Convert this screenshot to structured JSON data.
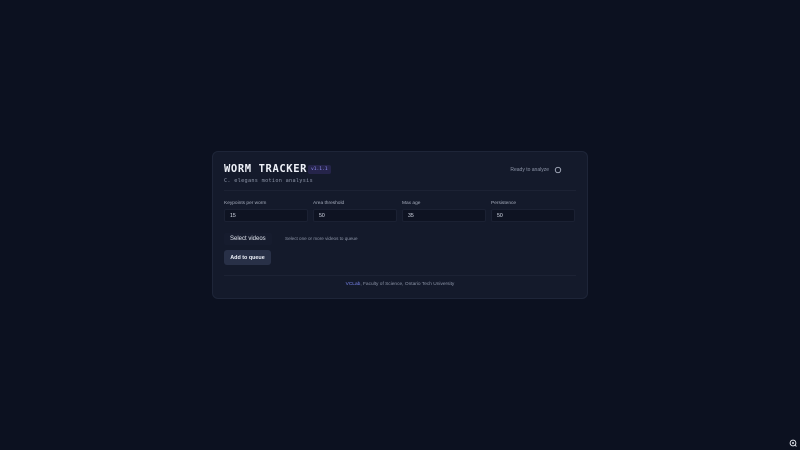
{
  "header": {
    "title": "WORM TRACKER",
    "version": "v1.1.1",
    "subtitle": "C. elegans motion analysis",
    "status": "Ready to analyze",
    "theme_icon": "circle-icon"
  },
  "fields": [
    {
      "label": "Keypoints per worm",
      "value": "15"
    },
    {
      "label": "Area threshold",
      "value": "50"
    },
    {
      "label": "Max age",
      "value": "35"
    },
    {
      "label": "Persistence",
      "value": "50"
    }
  ],
  "file_picker": {
    "button_label": "Select videos",
    "hint": "Select one or more videos to queue"
  },
  "actions": {
    "add_to_queue": "Add to queue"
  },
  "footer": {
    "link_text": "VCLab",
    "text": ", Faculty of Science, Ontario Tech University"
  },
  "colors": {
    "background": "#0c1120",
    "card": "#141a2b",
    "accent": "#7b86ee"
  }
}
